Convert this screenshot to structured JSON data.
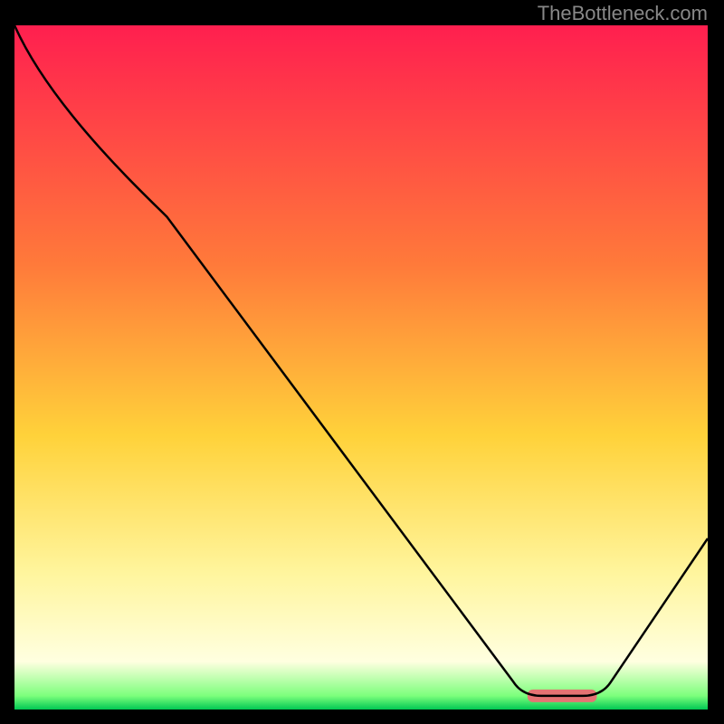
{
  "attribution": "TheBottleneck.com",
  "chart_data": {
    "type": "line",
    "title": "",
    "xlabel": "",
    "ylabel": "",
    "xlim": [
      0,
      100
    ],
    "ylim": [
      0,
      100
    ],
    "background_gradient": {
      "stops": [
        {
          "offset": 0.0,
          "color": "#ff1f4f"
        },
        {
          "offset": 0.35,
          "color": "#ff7a3a"
        },
        {
          "offset": 0.6,
          "color": "#ffd23a"
        },
        {
          "offset": 0.8,
          "color": "#fff59d"
        },
        {
          "offset": 0.93,
          "color": "#ffffe0"
        },
        {
          "offset": 0.98,
          "color": "#7cff7c"
        },
        {
          "offset": 1.0,
          "color": "#00c853"
        }
      ]
    },
    "series": [
      {
        "name": "bottleneck-curve",
        "color": "#000000",
        "points": [
          {
            "x": 0,
            "y": 100
          },
          {
            "x": 22,
            "y": 72
          },
          {
            "x": 72,
            "y": 4
          },
          {
            "x": 76,
            "y": 2
          },
          {
            "x": 82,
            "y": 2
          },
          {
            "x": 86,
            "y": 4
          },
          {
            "x": 100,
            "y": 25
          }
        ]
      }
    ],
    "marker": {
      "name": "optimal-range",
      "x_start": 74,
      "x_end": 84,
      "y": 2,
      "color": "#e57373"
    }
  }
}
